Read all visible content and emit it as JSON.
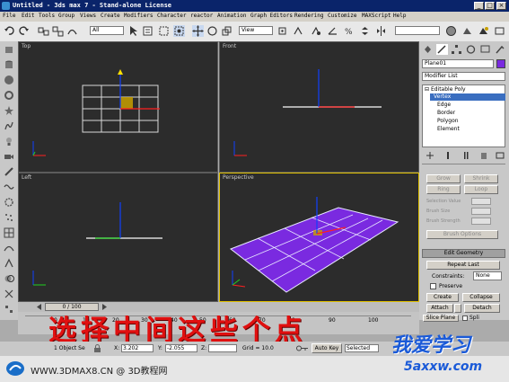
{
  "window": {
    "title": "Untitled - 3ds max 7 - Stand-alone License"
  },
  "menu": [
    "File",
    "Edit",
    "Tools",
    "Group",
    "Views",
    "Create",
    "Modifiers",
    "Character",
    "reactor",
    "Animation",
    "Graph Editors",
    "Rendering",
    "Customize",
    "MAXScript",
    "Help"
  ],
  "toolbar": {
    "selection_filter": "All",
    "ref_coord": "View"
  },
  "viewports": {
    "top_left": {
      "label": "Top"
    },
    "top_right": {
      "label": "Front"
    },
    "bottom_left": {
      "label": "Left"
    },
    "bottom_right": {
      "label": "Perspective"
    }
  },
  "panel": {
    "object_name": "Plane01",
    "modifier_list": "Modifier List",
    "stack": [
      "Editable Poly",
      "Vertex",
      "Edge",
      "Border",
      "Polygon",
      "Element"
    ],
    "stack_selected": "Vertex",
    "sel_buttons": {
      "grow": "Grow",
      "shrink": "Shrink",
      "ring": "Ring",
      "loop": "Loop"
    },
    "soft": {
      "selection_value": "Selection Value",
      "brush_size": "Brush Size",
      "brush_strength": "Brush Strength",
      "brush_options": "Brush Options"
    },
    "edit_geometry": "Edit Geometry",
    "repeat_last": "Repeat Last",
    "constraints_label": "Constraints:",
    "constraints_value": "None",
    "preserve_uvs": "Preserve",
    "create": "Create",
    "collapse": "Collapse",
    "attach": "Attach",
    "detach": "Detach",
    "slice_plane": "Slice Plane",
    "split": "Spli"
  },
  "timeline": {
    "frame": "0 / 100"
  },
  "track": {
    "ticks": [
      "0",
      "10",
      "20",
      "30",
      "40",
      "50",
      "60",
      "70",
      "80",
      "90",
      "100"
    ]
  },
  "annotation": "选择中间这些个点",
  "status": {
    "selection": "1 Object Se",
    "x_label": "X:",
    "x_value": "3.202",
    "y_label": "Y:",
    "y_value": "-2.055",
    "z_label": "Z:",
    "grid": "Grid = 10.0",
    "auto_key": "Auto Key",
    "selected": "Selected"
  },
  "watermark": {
    "left": "WWW.3DMAX8.CN @ 3D教程网",
    "logo_cn": "我爱学习",
    "logo_url": "5axxw.com"
  }
}
